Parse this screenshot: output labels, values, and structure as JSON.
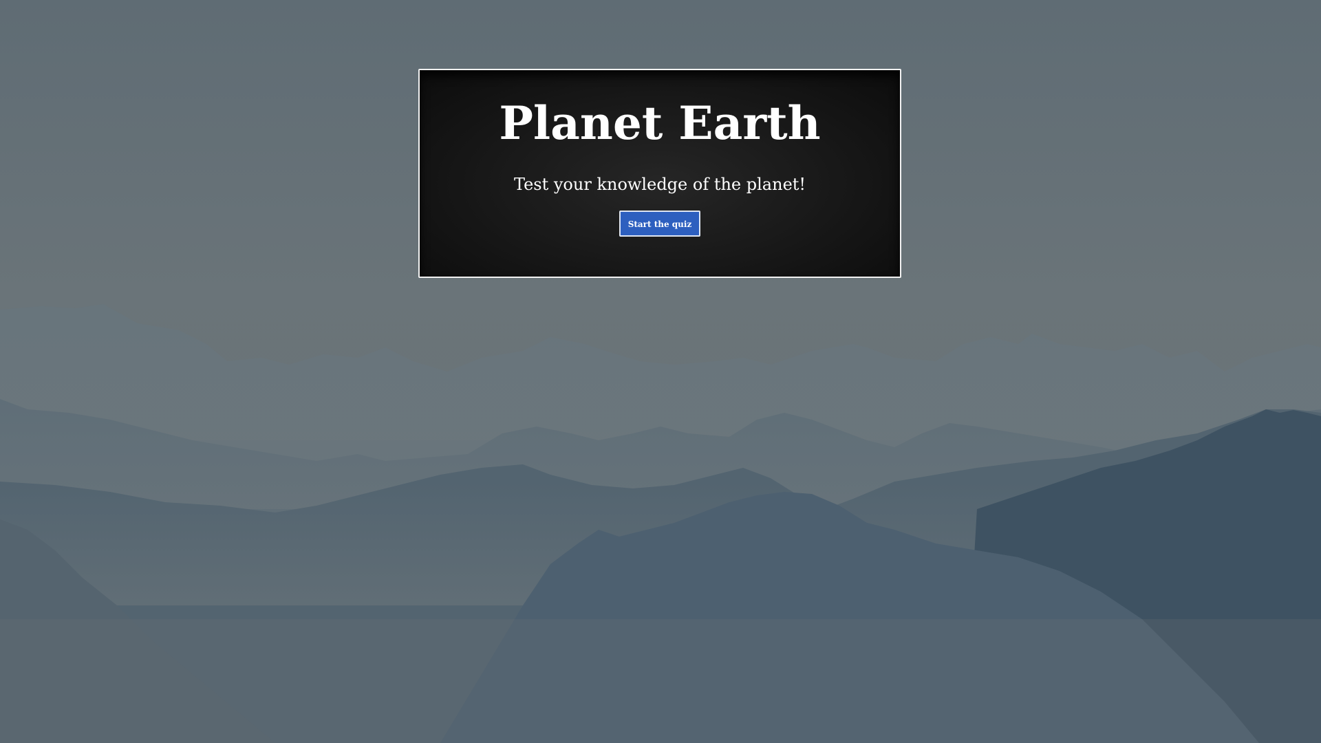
{
  "quiz": {
    "title": "Planet Earth",
    "subtitle": "Test your knowledge of the planet!",
    "start_label": "Start the quiz"
  },
  "colors": {
    "card_background": "#141414",
    "button_accent": "#2d5fbf",
    "sky": "#5f6c74",
    "mountain_far": "#6f7a80",
    "mountain_mid": "#5e6d77",
    "mountain_near": "#3f5262"
  }
}
